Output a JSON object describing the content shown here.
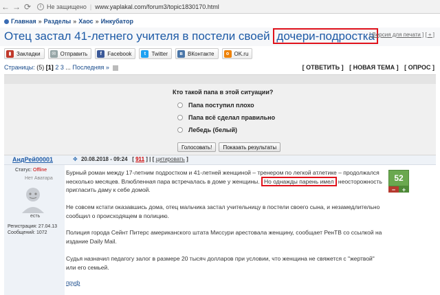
{
  "browser": {
    "security": "Не защищено",
    "url": "www.yaplakal.com/forum3/topic1830170.html"
  },
  "breadcrumb": [
    "Главная",
    "Разделы",
    "Хаос",
    "Инкубатор"
  ],
  "title": {
    "main": "Отец застал 41-летнего учителя в постели своей",
    "highlighted": "дочери-подростка"
  },
  "title_links": {
    "print": "[ Версия для печати ]",
    "plus": "[ + ]"
  },
  "share": [
    {
      "label": "Закладки",
      "icon": "bookmarks-icon",
      "color": "#c0392b"
    },
    {
      "label": "Отправить",
      "icon": "mail-icon",
      "color": "#7f8c8d"
    },
    {
      "label": "Facebook",
      "icon": "facebook-icon",
      "color": "#3b5998"
    },
    {
      "label": "Twitter",
      "icon": "twitter-icon",
      "color": "#1da1f2"
    },
    {
      "label": "ВКонтакте",
      "icon": "vk-icon",
      "color": "#4a76a8"
    },
    {
      "label": "OK.ru",
      "icon": "ok-icon",
      "color": "#ee8208"
    }
  ],
  "pages": {
    "label": "Страницы:",
    "count": "(5)",
    "current": "[1]",
    "p2": "2",
    "p3": "3",
    "dots": "...",
    "last": "Последняя »"
  },
  "actions": {
    "reply": "[ ОТВЕТИТЬ ]",
    "new_topic": "[ НОВАЯ ТЕМА ]",
    "poll": "[ ОПРОС ]"
  },
  "poll": {
    "question": "Кто такой папа в этой ситуации?",
    "options": [
      "Папа поступил плохо",
      "Папа всё сделал правильно",
      "Лебедь (белый)"
    ],
    "vote_button": "Голосовать!",
    "results_button": "Показать результаты"
  },
  "post": {
    "author": "АндРей00001",
    "date": "20.08.2018 - 09:24",
    "number": "911",
    "cite": "цитировать",
    "status_label": "Статус:",
    "status_value": "Offline",
    "no_avatar": "Нет Аватара",
    "avatar_caption": "есть",
    "registration": "Регистрация: 27.04.13",
    "messages": "Сообщений: 1072",
    "rating": "52",
    "paragraphs": {
      "p1_before": "Бурный роман между 17-летним подростком и 41-летней женщиной – тренером по легкой атлетике – продолжался несколько месяцев. Влюбленная пара встречалась в доме у женщины.",
      "p1_highlight": "Но однажды парень имел",
      "p1_after": "неосторожность пригласить даму к себе домой.",
      "p2": "Не совсем кстати оказавшись дома, отец мальчика застал учительницу в постели своего сына, и незамедлительно сообщил о происходящем в полицию.",
      "p3": "Полиция города Сейнт Питерс американского штата Миссури арестовала женщину, сообщает РенТВ со ссылкой на издание Daily Mail.",
      "p4": "Судья назначил педагогу залог в размере 20 тысяч долларов при условии, что женщина не свяжется с \"жертвой\" или его семьей."
    },
    "source": "пруф"
  }
}
